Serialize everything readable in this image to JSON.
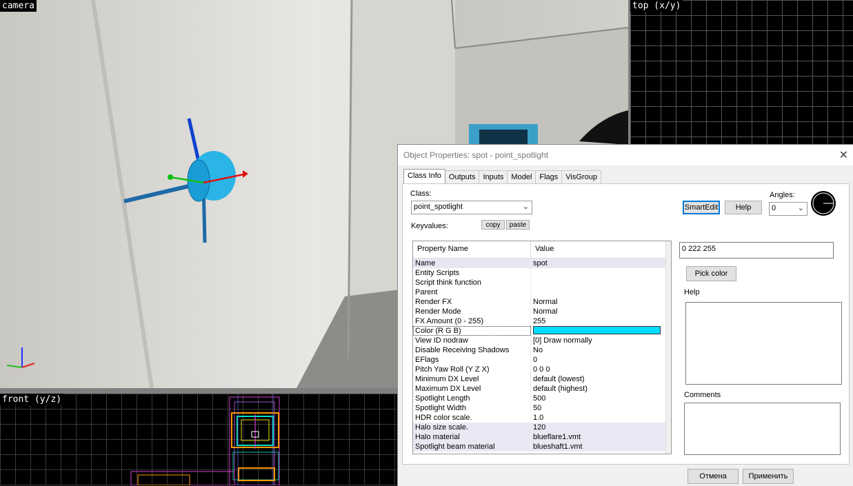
{
  "viewports": {
    "camera_label": "camera",
    "top_label": "top (x/y)",
    "front_label": "front (y/z)"
  },
  "dialog": {
    "title": "Object Properties: spot - point_spotlight",
    "close_glyph": "✕",
    "tabs": [
      "Class Info",
      "Outputs",
      "Inputs",
      "Model",
      "Flags",
      "VisGroup"
    ],
    "active_tab": "Class Info",
    "class_label": "Class:",
    "class_value": "point_spotlight",
    "keyvalues_label": "Keyvalues:",
    "copy_label": "copy",
    "paste_label": "paste",
    "smartedit_label": "SmartEdit",
    "help_button_label": "Help",
    "angles_label": "Angles:",
    "angles_value": "0",
    "columns": {
      "name": "Property Name",
      "value": "Value"
    },
    "properties": [
      {
        "name": "Name",
        "value": "spot"
      },
      {
        "name": "Entity Scripts",
        "value": ""
      },
      {
        "name": "Script think function",
        "value": ""
      },
      {
        "name": "Parent",
        "value": ""
      },
      {
        "name": "Render FX",
        "value": "Normal"
      },
      {
        "name": "Render Mode",
        "value": "Normal"
      },
      {
        "name": "FX Amount (0 - 255)",
        "value": "255"
      },
      {
        "name": "Color (R G B)",
        "value": ""
      },
      {
        "name": "View ID nodraw",
        "value": "[0] Draw normally"
      },
      {
        "name": "Disable Receiving Shadows",
        "value": "No"
      },
      {
        "name": "EFlags",
        "value": "0"
      },
      {
        "name": "Pitch Yaw Roll (Y Z X)",
        "value": "0 0 0"
      },
      {
        "name": "Minimum DX Level",
        "value": "default (lowest)"
      },
      {
        "name": "Maximum DX Level",
        "value": "default (highest)"
      },
      {
        "name": "Spotlight Length",
        "value": "500"
      },
      {
        "name": "Spotlight Width",
        "value": "50"
      },
      {
        "name": "HDR color scale.",
        "value": "1.0"
      },
      {
        "name": "Halo size scale.",
        "value": "120"
      },
      {
        "name": "Halo material",
        "value": "blueflare1.vmt"
      },
      {
        "name": "Spotlight beam material",
        "value": "blueshaft1.vmt"
      }
    ],
    "selected_color": "#00deff",
    "value_field": "0 222 255",
    "pick_color_label": "Pick color",
    "help_label": "Help",
    "comments_label": "Comments",
    "cancel_label": "Отмена",
    "apply_label": "Применить"
  }
}
